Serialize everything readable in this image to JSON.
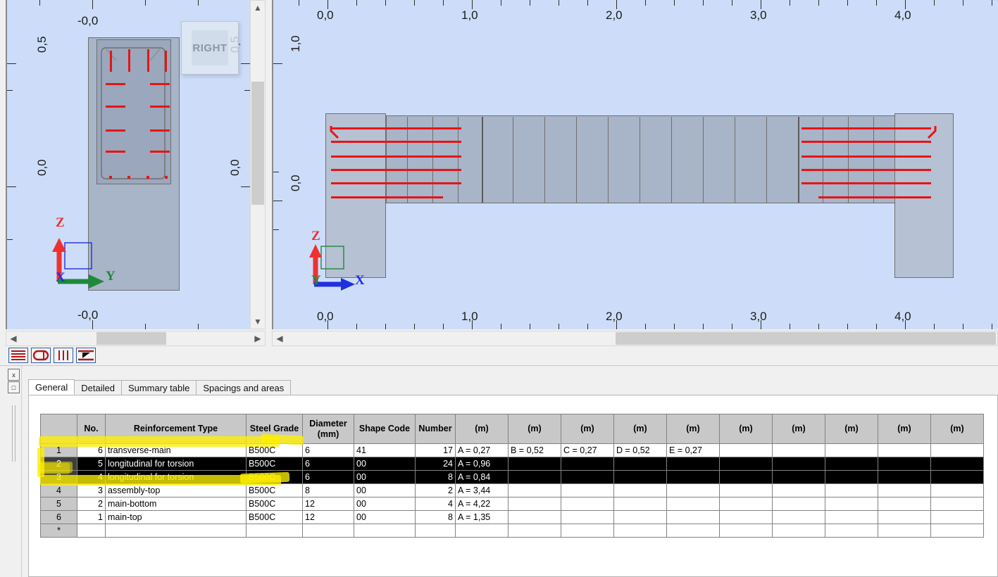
{
  "viewports": {
    "left": {
      "name": "cross-section-view",
      "view_cube_label": "RIGHT",
      "top_ruler_labels": [
        "-0,0"
      ],
      "bottom_ruler_labels": [
        "-0,0"
      ],
      "left_axis_labels": [
        "0,5",
        "0,0"
      ],
      "right_axis_labels": [
        "0,5",
        "0,0"
      ],
      "axes": {
        "z": "Z",
        "y": "Y",
        "x": "X"
      }
    },
    "right": {
      "name": "longitudinal-view",
      "top_ruler_labels": [
        "0,0",
        "1,0",
        "2,0",
        "3,0",
        "4,0"
      ],
      "bottom_ruler_labels": [
        "0,0",
        "1,0",
        "2,0",
        "3,0",
        "4,0"
      ],
      "left_axis_labels": [
        "1,0",
        "0,0"
      ],
      "axes": {
        "z": "Z",
        "x": "X",
        "y": "Y"
      }
    }
  },
  "toolbar": {
    "buttons": [
      {
        "name": "longitudinal-bars-icon",
        "title": "Longitudinal bars"
      },
      {
        "name": "stirrup-shape-icon",
        "title": "Stirrups"
      },
      {
        "name": "transverse-bars-icon",
        "title": "Transverse bars"
      },
      {
        "name": "section-view-icon",
        "title": "Section view"
      }
    ]
  },
  "left_strip": {
    "close_label": "x",
    "restore_label": "□"
  },
  "tabs": [
    {
      "label": "General",
      "active": true
    },
    {
      "label": "Detailed",
      "active": false
    },
    {
      "label": "Summary table",
      "active": false
    },
    {
      "label": "Spacings and areas",
      "active": false
    }
  ],
  "table": {
    "headers": [
      "",
      "No.",
      "Reinforcement Type",
      "Steel Grade",
      "Diameter\n(mm)",
      "Shape Code",
      "Number",
      "(m)",
      "(m)",
      "(m)",
      "(m)",
      "(m)",
      "(m)",
      "(m)",
      "(m)",
      "(m)",
      "(m)"
    ],
    "header_diameter_line1": "Diameter",
    "header_diameter_line2": "(mm)",
    "rows": [
      {
        "row_header": "1",
        "no": "6",
        "type": "transverse-main",
        "grade": "B500C",
        "diameter": "6",
        "shape_code": "41",
        "number": "17",
        "dims": [
          "A = 0,27",
          "B = 0,52",
          "C = 0,27",
          "D = 0,52",
          "E = 0,27",
          "",
          "",
          "",
          "",
          ""
        ],
        "selected": false
      },
      {
        "row_header": "2",
        "no": "5",
        "type": "longitudinal for torsion",
        "grade": "B500C",
        "diameter": "6",
        "shape_code": "00",
        "number": "24",
        "dims": [
          "A = 0,96",
          "",
          "",
          "",
          "",
          "",
          "",
          "",
          "",
          ""
        ],
        "selected": true
      },
      {
        "row_header": "3",
        "no": "4",
        "type": "longitudinal for torsion",
        "grade": "B500C",
        "diameter": "6",
        "shape_code": "00",
        "number": "8",
        "dims": [
          "A = 0,84",
          "",
          "",
          "",
          "",
          "",
          "",
          "",
          "",
          ""
        ],
        "selected": true
      },
      {
        "row_header": "4",
        "no": "3",
        "type": "assembly-top",
        "grade": "B500C",
        "diameter": "8",
        "shape_code": "00",
        "number": "2",
        "dims": [
          "A = 3,44",
          "",
          "",
          "",
          "",
          "",
          "",
          "",
          "",
          ""
        ],
        "selected": false
      },
      {
        "row_header": "5",
        "no": "2",
        "type": "main-bottom",
        "grade": "B500C",
        "diameter": "12",
        "shape_code": "00",
        "number": "4",
        "dims": [
          "A = 4,22",
          "",
          "",
          "",
          "",
          "",
          "",
          "",
          "",
          ""
        ],
        "selected": false
      },
      {
        "row_header": "6",
        "no": "1",
        "type": "main-top",
        "grade": "B500C",
        "diameter": "12",
        "shape_code": "00",
        "number": "8",
        "dims": [
          "A = 1,35",
          "",
          "",
          "",
          "",
          "",
          "",
          "",
          "",
          ""
        ],
        "selected": false
      },
      {
        "row_header": "*",
        "no": "",
        "type": "",
        "grade": "",
        "diameter": "",
        "shape_code": "",
        "number": "",
        "dims": [
          "",
          "",
          "",
          "",
          "",
          "",
          "",
          "",
          "",
          ""
        ],
        "selected": false
      }
    ]
  },
  "colors": {
    "viewport_background": "#cdddf9",
    "concrete": "#a8b4c8",
    "rebar": "#e81414",
    "axis_z": "#f03030",
    "axis_x": "#2030e0",
    "axis_y": "#1d8a3a",
    "highlighter": "#fff000",
    "selection": "#000000"
  }
}
